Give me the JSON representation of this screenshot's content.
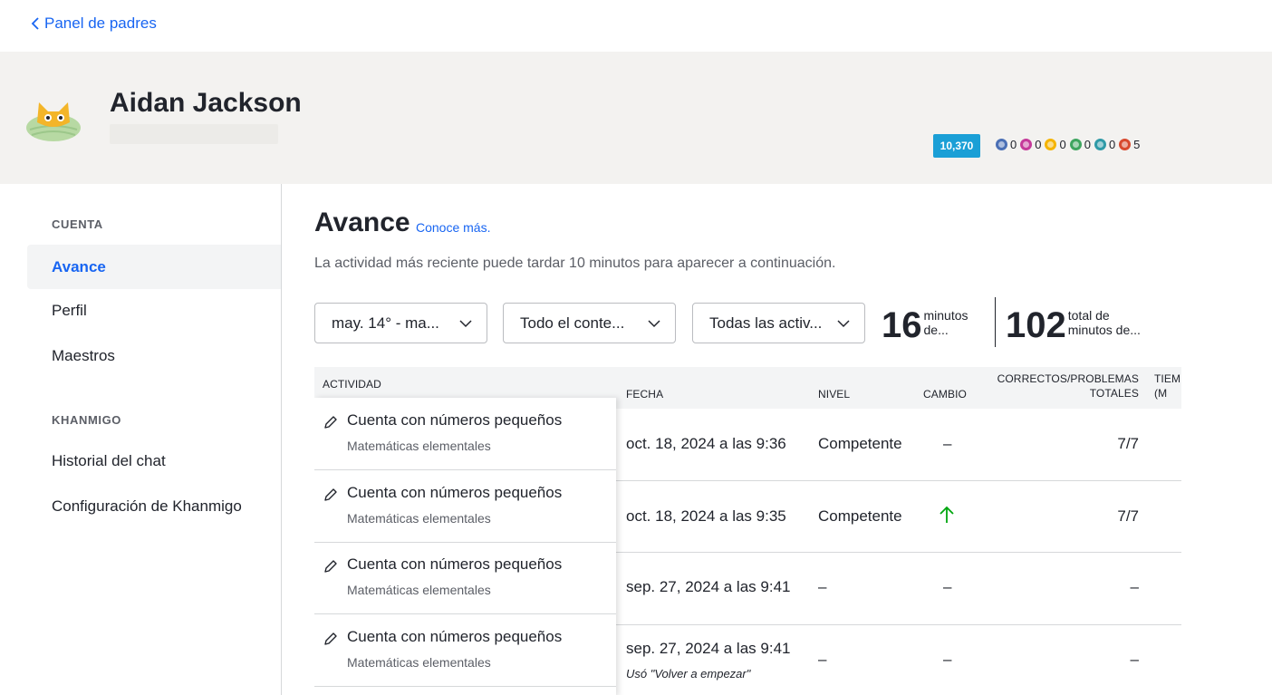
{
  "nav": {
    "back_label": "Panel de padres"
  },
  "profile": {
    "name": "Aidan Jackson",
    "points": "10,370",
    "badges": [
      {
        "icon": "meteorite-badge-icon",
        "color": "#4a6fb5",
        "count": "0"
      },
      {
        "icon": "moon-badge-icon",
        "color": "#c53a9a",
        "count": "0"
      },
      {
        "icon": "earth-badge-icon",
        "color": "#f5b400",
        "count": "0"
      },
      {
        "icon": "sun-badge-icon",
        "color": "#3ea55f",
        "count": "0"
      },
      {
        "icon": "black-hole-badge-icon",
        "color": "#2f9aa7",
        "count": "0"
      },
      {
        "icon": "challenge-patch-icon",
        "color": "#d8492e",
        "count": "5"
      }
    ]
  },
  "sidebar": {
    "section_account": "CUENTA",
    "items_account": [
      "Avance",
      "Perfil",
      "Maestros"
    ],
    "section_khanmigo": "KHANMIGO",
    "items_khanmigo": [
      "Historial del chat",
      "Configuración de Khanmigo"
    ],
    "active": "Avance"
  },
  "main": {
    "title": "Avance",
    "learn_more": "Conoce más.",
    "subtitle": "La actividad más reciente puede tardar 10 minutos para aparecer a continuación.",
    "filters": {
      "date": "may. 14° - ma...",
      "content": "Todo el conte...",
      "activity": "Todas las activ..."
    },
    "stats": [
      {
        "value": "16",
        "label_line1": "minutos",
        "label_line2": "de..."
      },
      {
        "value": "102",
        "label_line1": "total de",
        "label_line2": "minutos de..."
      }
    ],
    "table": {
      "headers": {
        "activity": "ACTIVIDAD",
        "date": "FECHA",
        "level": "NIVEL",
        "change": "CAMBIO",
        "correct_line1": "CORRECTOS/PROBLEMAS",
        "correct_line2": "TOTALES",
        "time_line1": "TIEM",
        "time_line2": "(M"
      },
      "rows": [
        {
          "title": "Cuenta con números pequeños",
          "course": "Matemáticas elementales",
          "date": "oct. 18, 2024 a las 9:36",
          "note": "",
          "level": "Competente",
          "change": "–",
          "correct": "7/7"
        },
        {
          "title": "Cuenta con números pequeños",
          "course": "Matemáticas elementales",
          "date": "oct. 18, 2024 a las 9:35",
          "note": "",
          "level": "Competente",
          "change": "up",
          "correct": "7/7"
        },
        {
          "title": "Cuenta con números pequeños",
          "course": "Matemáticas elementales",
          "date": "sep. 27, 2024 a las 9:41",
          "note": "",
          "level": "–",
          "change": "–",
          "correct": "–"
        },
        {
          "title": "Cuenta con números pequeños",
          "course": "Matemáticas elementales",
          "date": "sep. 27, 2024 a las 9:41",
          "note": "Usó \"Volver a empezar\"",
          "level": "–",
          "change": "–",
          "correct": "–"
        }
      ]
    }
  },
  "colors": {
    "link": "#1865f2",
    "points_badge": "#1a9fd6",
    "header_bg": "#f3f2f0",
    "up_arrow": "#00a60e"
  }
}
